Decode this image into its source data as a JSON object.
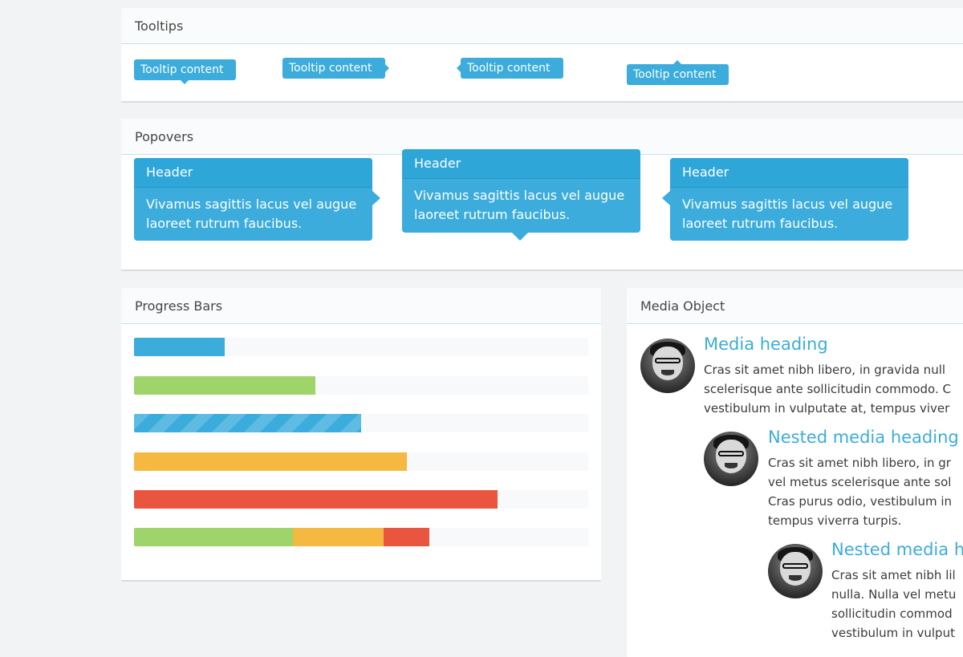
{
  "tooltips": {
    "title": "Tooltips",
    "items": [
      {
        "label": "Tooltip content",
        "placement": "bottom"
      },
      {
        "label": "Tooltip content",
        "placement": "right"
      },
      {
        "label": "Tooltip content",
        "placement": "left"
      },
      {
        "label": "Tooltip content",
        "placement": "top"
      }
    ]
  },
  "popovers": {
    "title": "Popovers",
    "items": [
      {
        "header": "Header",
        "line1": "Vivamus sagittis lacus vel augue",
        "line2": "laoreet rutrum faucibus.",
        "placement": "right"
      },
      {
        "header": "Header",
        "line1": "Vivamus sagittis lacus vel augue",
        "line2": "laoreet rutrum faucibus.",
        "placement": "bottom"
      },
      {
        "header": "Header",
        "line1": "Vivamus sagittis lacus vel augue",
        "line2": "laoreet rutrum faucibus.",
        "placement": "left"
      }
    ]
  },
  "progress": {
    "title": "Progress Bars",
    "bars": [
      {
        "percent": 20,
        "color": "#3bacdb",
        "style": "solid"
      },
      {
        "percent": 40,
        "color": "#9fd46a",
        "style": "solid"
      },
      {
        "percent": 50,
        "color": "#3bacdb",
        "style": "striped"
      },
      {
        "percent": 60,
        "color": "#f5b942",
        "style": "solid"
      },
      {
        "percent": 80,
        "color": "#e9553e",
        "style": "solid"
      },
      {
        "stacked": [
          {
            "percent": 35,
            "color": "#9fd46a"
          },
          {
            "percent": 20,
            "color": "#f5b942"
          },
          {
            "percent": 10,
            "color": "#e9553e"
          }
        ]
      }
    ]
  },
  "media": {
    "title": "Media Object",
    "items": [
      {
        "heading": "Media heading",
        "lines": [
          "Cras sit amet nibh libero, in gravida null",
          "scelerisque ante sollicitudin commodo. C",
          "vestibulum in vulputate at, tempus viver"
        ]
      },
      {
        "heading": "Nested media heading",
        "lines": [
          "Cras sit amet nibh libero, in gr",
          "vel metus scelerisque ante sol",
          "Cras purus odio, vestibulum in",
          "tempus viverra turpis."
        ]
      },
      {
        "heading": "Nested media he",
        "lines": [
          "Cras sit amet nibh lil",
          "nulla. Nulla vel metu",
          "sollicitudin commod",
          "vestibulum in vulput"
        ]
      }
    ]
  },
  "colors": {
    "accent": "#3bacdb",
    "success": "#9fd46a",
    "warning": "#f5b942",
    "danger": "#e9553e",
    "background": "#f2f3f5"
  }
}
